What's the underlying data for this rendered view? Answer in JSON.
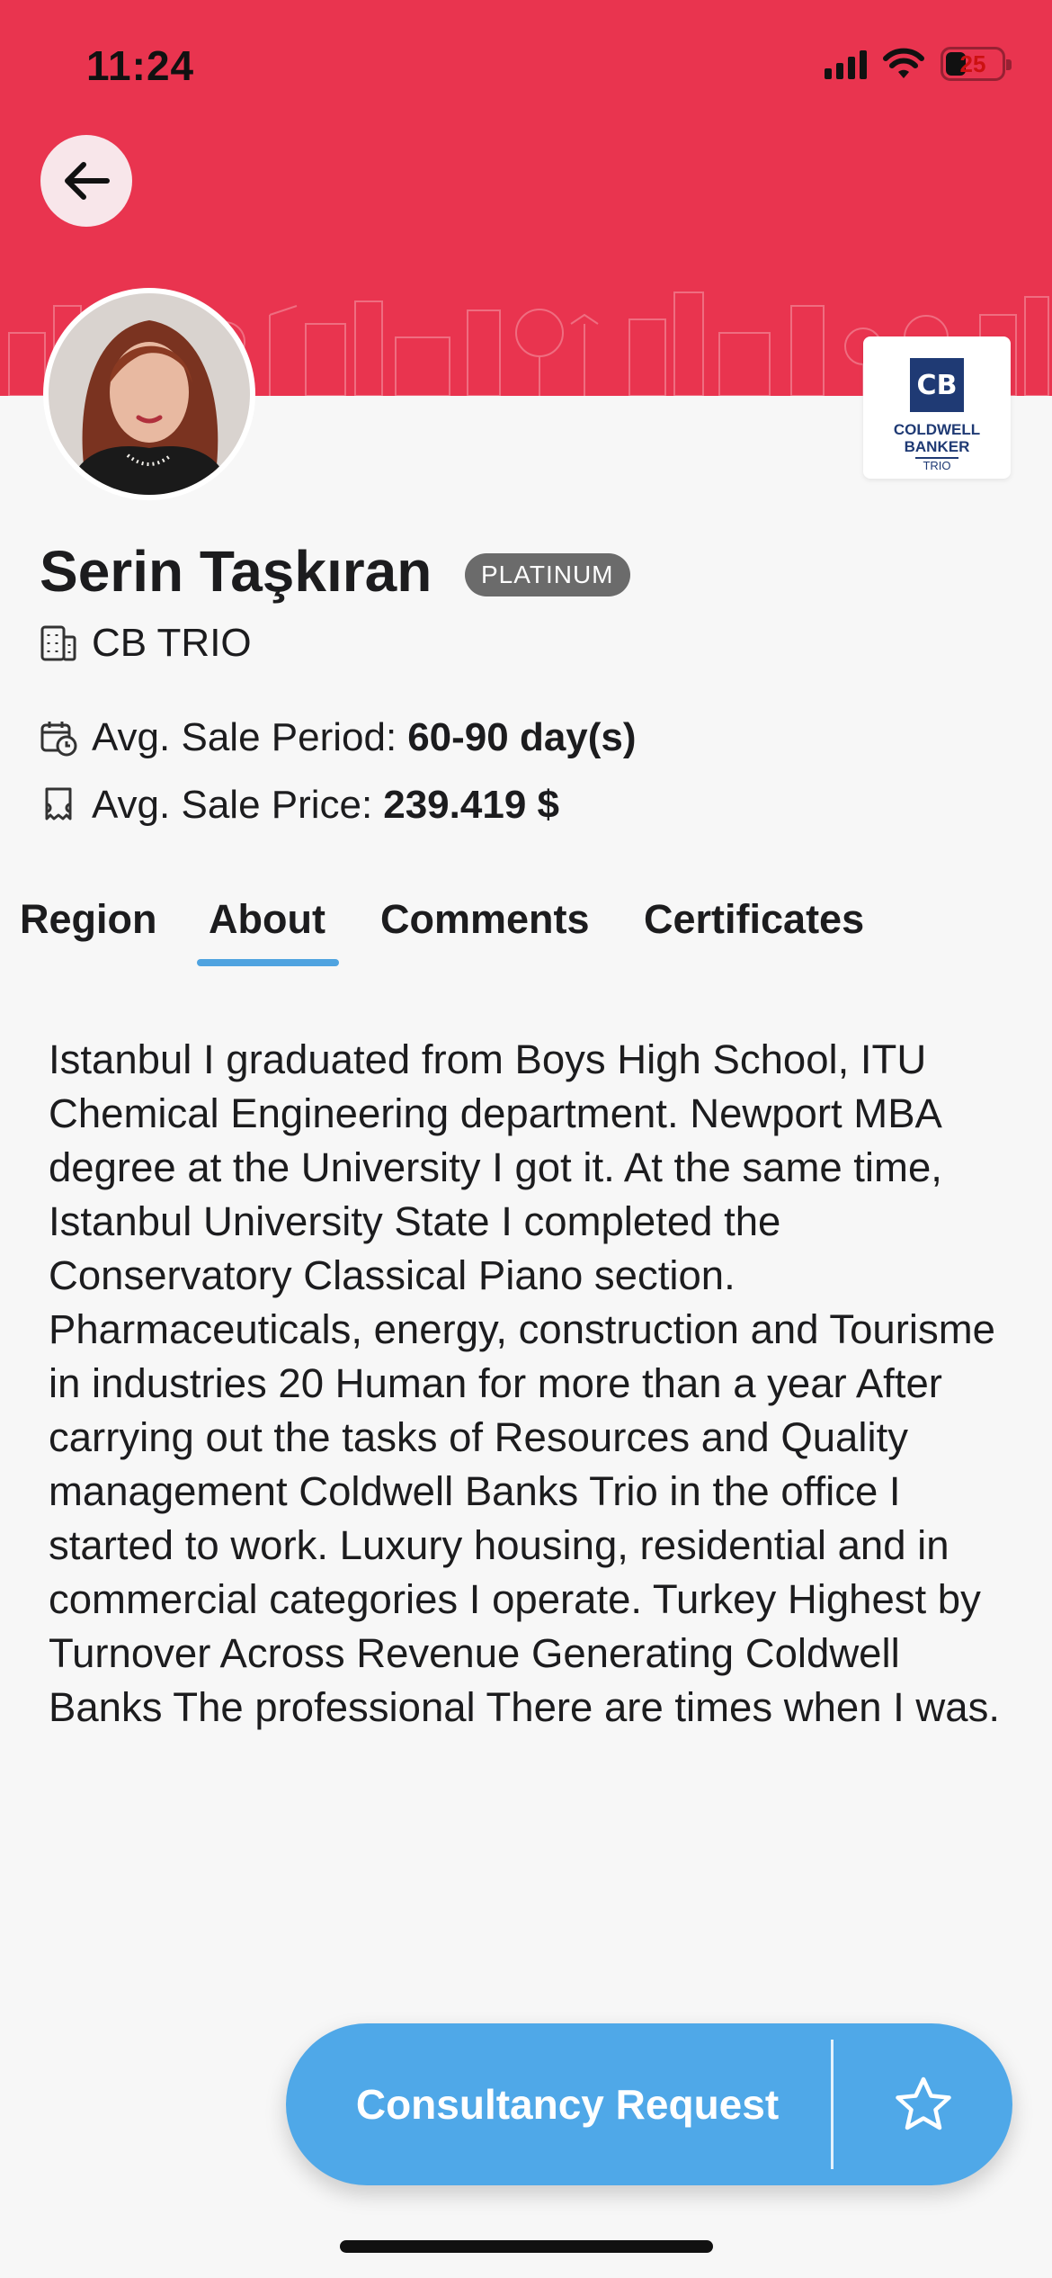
{
  "status_bar": {
    "time": "11:24",
    "battery": "25"
  },
  "profile": {
    "name": "Serin Taşkıran",
    "tier_badge": "PLATINUM",
    "office": "CB TRIO"
  },
  "logo": {
    "line1": "COLDWELL",
    "line2": "BANKER",
    "line3": "TRIO"
  },
  "stats": {
    "period_label": "Avg. Sale Period:",
    "period_value": "60-90 day(s)",
    "price_label": "Avg. Sale Price:",
    "price_value": "239.419 $"
  },
  "tabs": [
    {
      "label": "Region",
      "active": false
    },
    {
      "label": "About",
      "active": true
    },
    {
      "label": "Comments",
      "active": false
    },
    {
      "label": "Certificates",
      "active": false
    }
  ],
  "about": {
    "text": "Istanbul I graduated from Boys High School, ITU Chemical Engineering department. Newport MBA degree at the University I got it. At the same time, Istanbul University State I completed the Conservatory Classical Piano section. Pharmaceuticals, energy, construction and Tourisme in industries 20 Human for more than a year After carrying out the tasks of Resources and Quality management Coldwell Banks Trio in the office I started to work. Luxury housing, residential and in commercial categories I operate. Turkey Highest by Turnover Across Revenue Generating Coldwell Banks The professional There are times when I was."
  },
  "cta": {
    "label": "Consultancy Request"
  },
  "colors": {
    "header": "#e9344f",
    "accent": "#4fa8e8",
    "tab_indicator": "#4fa3e0",
    "badge": "#6b6b6b"
  },
  "icons": [
    "arrow-left-icon",
    "signal-icon",
    "wifi-icon",
    "battery-icon",
    "building-icon",
    "calendar-clock-icon",
    "price-tag-icon",
    "star-icon"
  ]
}
